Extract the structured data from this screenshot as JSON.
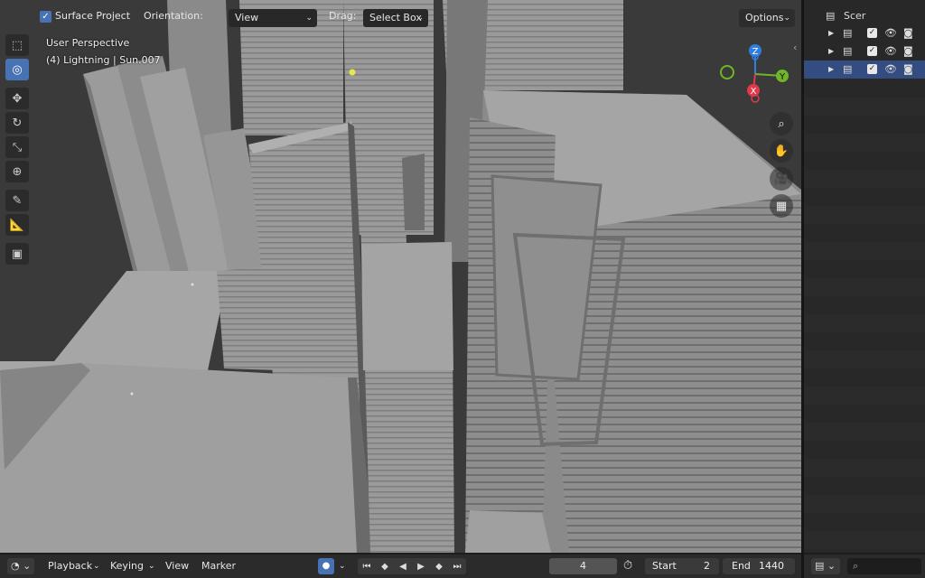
{
  "header": {
    "surface_project_label": "Surface Project",
    "orientation_label": "Orientation:",
    "orientation_value": "View",
    "drag_label": "Drag:",
    "drag_value": "Select Box",
    "options_label": "Options"
  },
  "overlay": {
    "view_name": "User Perspective",
    "object_info": "(4) Lightning | Sun.007"
  },
  "outliner": {
    "root_label": "Scer"
  },
  "timeline": {
    "playback_label": "Playback",
    "keying_label": "Keying",
    "view_label": "View",
    "marker_label": "Marker",
    "current_frame": "4",
    "start_label": "Start",
    "start_value": "2",
    "end_label": "End",
    "end_value": "1440"
  },
  "gizmo": {
    "x_label": "X",
    "y_label": "Y",
    "z_label": "Z"
  },
  "colors": {
    "accent": "#4772b3",
    "axis_x": "#e0394b",
    "axis_y": "#6fb52a",
    "axis_z": "#2f7fe0"
  }
}
